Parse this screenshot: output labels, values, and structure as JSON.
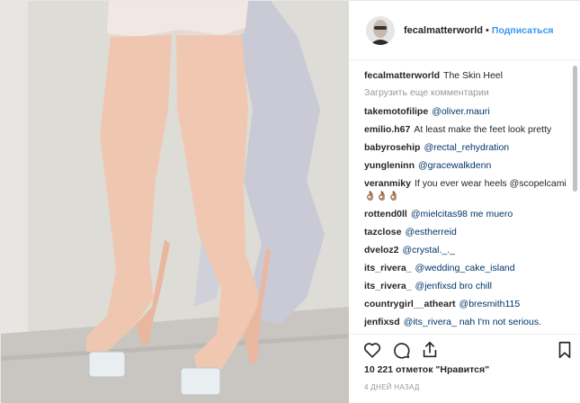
{
  "post": {
    "author": "fecalmatterworld",
    "follow_label": "Подписаться",
    "dot": "•",
    "caption": {
      "user": "fecalmatterworld",
      "text": "The Skin Heel"
    },
    "load_more": "Загрузить еще комментарии",
    "comments": [
      {
        "user": "takemotofilipe",
        "text": "@oliver.mauri"
      },
      {
        "user": "emilio.h67",
        "text": "At least make the feet look pretty"
      },
      {
        "user": "babyrosehip",
        "text": "@rectal_rehydration"
      },
      {
        "user": "yungleninn",
        "text": "@gracewalkdenn"
      },
      {
        "user": "veranmiky",
        "text": "If you ever wear heels @scopelcami 👌🏽👌🏽👌🏽"
      },
      {
        "user": "rottend0ll",
        "text": "@mielcitas98 me muero"
      },
      {
        "user": "tazclose",
        "text": "@estherreid"
      },
      {
        "user": "dveloz2",
        "text": "@crystal._._"
      },
      {
        "user": "its_rivera_",
        "text": "@wedding_cake_island"
      },
      {
        "user": "its_rivera_",
        "text": "@jenfixsd bro chill"
      },
      {
        "user": "countrygirl__atheart",
        "text": "@bresmith115"
      },
      {
        "user": "jenfixsd",
        "text": "@its_rivera_ nah I'm not serious."
      }
    ],
    "likes": "10 221 отметок \"Нравится\"",
    "date": "4 ДНЕЙ НАЗАД"
  },
  "icons": {
    "like": "heart-icon",
    "comment": "comment-bubble-icon",
    "share": "share-icon",
    "save": "bookmark-icon"
  },
  "colors": {
    "accent": "#3897f0",
    "text": "#262626",
    "muted": "#999999",
    "mention": "#003569"
  }
}
